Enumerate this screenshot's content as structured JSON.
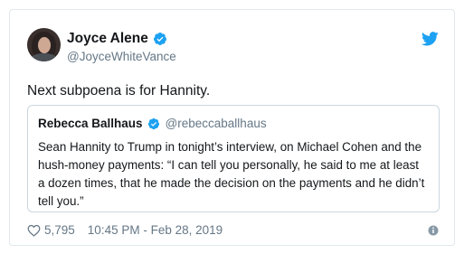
{
  "tweet": {
    "author": {
      "name": "Joyce Alene",
      "handle": "@JoyceWhiteVance",
      "verified": true
    },
    "text": "Next subpoena is for Hannity.",
    "quoted": {
      "author": {
        "name": "Rebecca Ballhaus",
        "handle": "@rebeccaballhaus",
        "verified": true
      },
      "text": "Sean Hannity to Trump in tonight’s interview, on Michael Cohen and the hush-money payments: “I can tell you personally, he said to me at least a dozen times, that he made the decision on the payments and he didn’t tell you.”"
    },
    "likes": "5,795",
    "timestamp": "10:45 PM - Feb 28, 2019"
  },
  "icons": {
    "brand": "twitter-bird-icon",
    "verified": "verified-badge-icon",
    "like": "heart-icon",
    "info": "info-icon"
  },
  "colors": {
    "twitter_blue": "#1da1f2",
    "text": "#14171a",
    "secondary_text": "#657786",
    "border": "#e1e8ed"
  }
}
